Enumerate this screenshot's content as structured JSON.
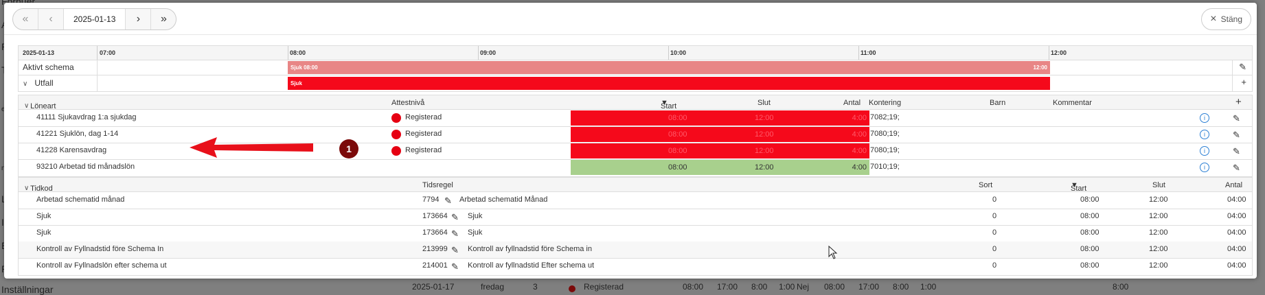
{
  "background": {
    "items": [
      "Fornuer",
      "A",
      "P",
      "T",
      "en",
      "ne",
      "Li",
      "In",
      "E",
      "R",
      "Inställningar"
    ],
    "row": [
      "2025-01-17",
      "fredag",
      "3",
      "Registerad",
      "08:00",
      "17:00",
      "8:00",
      "1:00",
      "Nej",
      "08:00",
      "17:00",
      "8:00",
      "1:00",
      "8:00"
    ]
  },
  "nav": {
    "date": "2025-01-13",
    "first": "«",
    "prev": "‹",
    "next": "›",
    "last": "»",
    "close_label": "Stäng",
    "close_icon": "×"
  },
  "timeline": {
    "date": "2025-01-13",
    "hours": [
      "07:00",
      "08:00",
      "09:00",
      "10:00",
      "11:00",
      "12:00"
    ],
    "row1_label": "Aktivt schema",
    "row1_bar_start": "Sjuk 08:00",
    "row1_bar_end": "12:00",
    "row2_label": "Utfall",
    "row2_bar": "Sjuk",
    "edit_icon": "✎",
    "add_icon": "+"
  },
  "wage_table": {
    "headers": {
      "col1": "Löneart",
      "col2": "Attestnivå",
      "start": "Start",
      "slut": "Slut",
      "antal": "Antal",
      "kontering": "Kontering",
      "barn": "Barn",
      "kommentar": "Kommentar",
      "add": "+"
    },
    "rows": [
      {
        "name": "41111 Sjukavdrag 1:a sjukdag",
        "status": "Registerad",
        "start": "08:00",
        "slut": "12:00",
        "antal": "4:00",
        "kontering": "7082;19;",
        "color": "#f5091b"
      },
      {
        "name": "41221 Sjuklön, dag 1-14",
        "status": "Registerad",
        "start": "08:00",
        "slut": "12:00",
        "antal": "4:00",
        "kontering": "7080;19;",
        "color": "#f5091b"
      },
      {
        "name": "41228 Karensavdrag",
        "status": "Registerad",
        "start": "08:00",
        "slut": "12:00",
        "antal": "4:00",
        "kontering": "7080;19;",
        "color": "#f5091b"
      },
      {
        "name": "93210 Arbetad tid månadslön",
        "status": "",
        "start": "08:00",
        "slut": "12:00",
        "antal": "4:00",
        "kontering": "7010;19;",
        "color": "#a8d08d"
      }
    ]
  },
  "time_table": {
    "headers": {
      "col1": "Tidkod",
      "col2": "Tidsregel",
      "sort": "Sort",
      "start": "Start",
      "slut": "Slut",
      "antal": "Antal"
    },
    "rows": [
      {
        "kod": "Arbetad schematid månad",
        "id": "7794",
        "regel": "Arbetad schematid Månad",
        "sort": "0",
        "start": "08:00",
        "slut": "12:00",
        "antal": "04:00"
      },
      {
        "kod": "Sjuk",
        "id": "173664",
        "regel": "Sjuk",
        "sort": "0",
        "start": "08:00",
        "slut": "12:00",
        "antal": "04:00"
      },
      {
        "kod": "Sjuk",
        "id": "173664",
        "regel": "Sjuk",
        "sort": "0",
        "start": "08:00",
        "slut": "12:00",
        "antal": "04:00"
      },
      {
        "kod": "Kontroll av Fyllnadstid före Schema In",
        "id": "213999",
        "regel": "Kontroll av fyllnadstid före Schema in",
        "sort": "0",
        "start": "08:00",
        "slut": "12:00",
        "antal": "04:00"
      },
      {
        "kod": "Kontroll av Fyllnadslön efter schema ut",
        "id": "214001",
        "regel": "Kontroll av fyllnadstid Efter schema ut",
        "sort": "0",
        "start": "08:00",
        "slut": "12:00",
        "antal": "04:00"
      }
    ]
  },
  "annotation": {
    "badge": "1"
  }
}
